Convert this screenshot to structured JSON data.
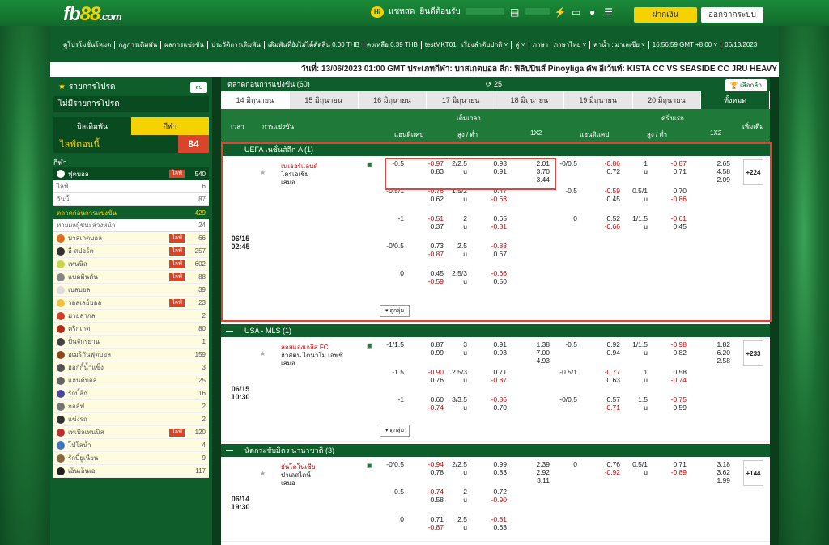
{
  "header": {
    "logo_main": "fb",
    "logo_num": "88",
    "logo_suffix": ".com",
    "chat": "แชทสด",
    "welcome": "ยินดีต้อนรับ",
    "deposit_label": "ฝากเงิน",
    "logout_label": "ออกจากระบบ",
    "hi": "Hi"
  },
  "nav": {
    "left": [
      "ดูโปรโมชั่นโหมด",
      "กฎการเดิมพัน",
      "ผลการแข่งขัน",
      "ประวัติการเดิมพัน",
      "เดิมพันที่ยังไม่ได้ตัดสิน 0.00 THB",
      "คงเหลือ 0.39 THB",
      "testMKT01"
    ],
    "right": [
      "เรียงลำดับปกติ ˅",
      "คู่ ˅",
      "ภาษา : ภาษาไทย ˅",
      "ค่าน้ำ : มาเลเซีย ˅",
      "16:56:59 GMT +8:00 ˅",
      "06/13/2023"
    ]
  },
  "ticker": "วันที่: 13/06/2023 01:00 GMT ประเภทกีฬา: บาสเกตบอล ลีก: ฟิลิปปินส์ Pinoyliga คัพ อีเว้นท์: KISTA CC VS SEASIDE CC JRU HEAVY",
  "sidebar": {
    "fav_title": "รายการโปรด",
    "fav_btn": "ลบ",
    "fav_none": "ไม่มีรายการโปรด",
    "tab_bets": "บิลเดิมพัน",
    "tab_sport": "กีฬา",
    "live_today": "ไลฟ์ตอนนี้",
    "live_count": "84",
    "sports_title": "กีฬา",
    "rows": [
      {
        "label": "ฟุตบอล",
        "live": "ไลฟ์",
        "count": "540",
        "style": "dk",
        "color": "#ffffff"
      },
      {
        "label": "ไลฟ์",
        "count": "6",
        "style": "wh"
      },
      {
        "label": "วันนี้",
        "count": "87",
        "style": "wh"
      },
      {
        "label": "ตลาดก่อนการแข่งขัน",
        "count": "429",
        "style": "hl"
      },
      {
        "label": "ทายผลผู้ชนะล่วงหน้า",
        "count": "24",
        "style": "wh"
      },
      {
        "label": "บาสเกตบอล",
        "live": "ไลฟ์",
        "count": "66",
        "style": "yl",
        "color": "#e07020"
      },
      {
        "label": "อี-สปอร์ต",
        "live": "ไลฟ์",
        "count": "257",
        "style": "yl",
        "color": "#333333"
      },
      {
        "label": "เทนนิส",
        "live": "ไลฟ์",
        "count": "602",
        "style": "yl",
        "color": "#c8d64a"
      },
      {
        "label": "แบดมินตัน",
        "live": "ไลฟ์",
        "count": "88",
        "style": "yl",
        "color": "#888888"
      },
      {
        "label": "เบสบอล",
        "count": "39",
        "style": "yl",
        "color": "#dddddd"
      },
      {
        "label": "วอลเลย์บอล",
        "live": "ไลฟ์",
        "count": "23",
        "style": "yl",
        "color": "#f0c040"
      },
      {
        "label": "มวยสากล",
        "count": "2",
        "style": "yl",
        "color": "#d04030"
      },
      {
        "label": "คริกเกต",
        "count": "80",
        "style": "yl",
        "color": "#b03020"
      },
      {
        "label": "ปั่นจักรยาน",
        "count": "1",
        "style": "yl",
        "color": "#444444"
      },
      {
        "label": "อเมริกันฟุตบอล",
        "count": "159",
        "style": "yl",
        "color": "#8a4a20"
      },
      {
        "label": "ฮอกกี้น้ำแข็ง",
        "count": "3",
        "style": "yl",
        "color": "#555555"
      },
      {
        "label": "แฮนด์บอล",
        "count": "25",
        "style": "yl",
        "color": "#666666"
      },
      {
        "label": "รักบี้ลีก",
        "count": "16",
        "style": "yl",
        "color": "#4a4a9a"
      },
      {
        "label": "กอล์ฟ",
        "count": "2",
        "style": "yl",
        "color": "#777777"
      },
      {
        "label": "แข่งรถ",
        "count": "2",
        "style": "yl",
        "color": "#333333"
      },
      {
        "label": "เทเบิลเทนนิส",
        "live": "ไลฟ์",
        "count": "120",
        "style": "yl",
        "color": "#c03030"
      },
      {
        "label": "โปโลน้ำ",
        "count": "4",
        "style": "yl",
        "color": "#3a7ac0"
      },
      {
        "label": "รักบี้ยูเนียน",
        "count": "9",
        "style": "yl",
        "color": "#8a6a40"
      },
      {
        "label": "เอ็นเอ็นเอ",
        "count": "117",
        "style": "yl",
        "color": "#222222"
      }
    ]
  },
  "main": {
    "title": "ตลาดก่อนการแข่งขัน (60)",
    "refresh": "25",
    "select_label": "เลือกลีก",
    "date_tabs": [
      "14 มิถุนายน",
      "15 มิถุนายน",
      "16 มิถุนายน",
      "17 มิถุนายน",
      "18 มิถุนายน",
      "19 มิถุนายน",
      "20 มิถุนายน",
      "ทั้งหมด"
    ],
    "cols": {
      "time": "เวลา",
      "match": "การแข่งขัน",
      "fulltime": "เต็มเวลา",
      "halftime": "ครึ่งแรก",
      "hdp": "แฮนดิแคป",
      "ou": "สูง / ต่ำ",
      "x12": "1X2",
      "more": "เพิ่มเติม"
    },
    "expand": "ดูกลุ่ม"
  },
  "leagues": [
    {
      "name": "UEFA เนชั่นส์ลีก A (1)",
      "time": "06/15",
      "time2": "02:45",
      "home": "เนเธอร์แลนด์",
      "away": "โครเอเชีย",
      "draw": "เสมอ",
      "more": "+224",
      "rows": [
        [
          "-0.5",
          "-0.97",
          "0.83",
          "2/2.5",
          "u",
          "0.93",
          "0.91",
          "2.01",
          "3.70",
          "3.44",
          "-0/0.5",
          "-0.86",
          "0.72",
          "1",
          "u",
          "-0.87",
          "0.71",
          "2.65",
          "4.58",
          "2.09"
        ],
        [
          "-0.5/1",
          "-0.76",
          "0.62",
          "1.5/2",
          "u",
          "0.47",
          "-0.63",
          "",
          "",
          "",
          "-0.5",
          "-0.59",
          "0.45",
          "0.5/1",
          "u",
          "0.70",
          "-0.86",
          "",
          "",
          ""
        ],
        [
          "-1",
          "-0.51",
          "0.37",
          "2",
          "u",
          "0.65",
          "-0.81",
          "",
          "",
          "",
          "0",
          "0.52",
          "-0.66",
          "1/1.5",
          "u",
          "-0.61",
          "0.45",
          "",
          "",
          ""
        ],
        [
          "-0/0.5",
          "0.73",
          "-0.87",
          "2.5",
          "u",
          "-0.83",
          "0.67",
          "",
          "",
          "",
          "",
          "",
          "",
          "",
          "",
          "",
          "",
          "",
          "",
          ""
        ],
        [
          "0",
          "0.45",
          "-0.59",
          "2.5/3",
          "u",
          "-0.66",
          "0.50",
          "",
          "",
          "",
          "",
          "",
          "",
          "",
          "",
          "",
          "",
          "",
          "",
          ""
        ]
      ]
    },
    {
      "name": "USA - MLS (1)",
      "time": "06/15",
      "time2": "10:30",
      "home": "ลอสแองเจลิส FC",
      "away": "ฮิวสตัน ไดนาโม เอฟซี",
      "draw": "เสมอ",
      "more": "+233",
      "rows": [
        [
          "-1/1.5",
          "0.87",
          "0.99",
          "3",
          "u",
          "0.91",
          "0.93",
          "1.38",
          "7.00",
          "4.93",
          "-0.5",
          "0.92",
          "0.94",
          "1/1.5",
          "u",
          "-0.98",
          "0.82",
          "1.82",
          "6.20",
          "2.58"
        ],
        [
          "-1.5",
          "-0.90",
          "0.76",
          "2.5/3",
          "u",
          "0.71",
          "-0.87",
          "",
          "",
          "",
          "-0.5/1",
          "-0.77",
          "0.63",
          "1",
          "u",
          "0.58",
          "-0.74",
          "",
          "",
          ""
        ],
        [
          "-1",
          "0.60",
          "-0.74",
          "3/3.5",
          "u",
          "-0.86",
          "0.70",
          "",
          "",
          "",
          "-0/0.5",
          "0.57",
          "-0.71",
          "1.5",
          "u",
          "-0.75",
          "0.59",
          "",
          "",
          ""
        ]
      ]
    },
    {
      "name": "นัดกระชับมิตร นานาชาติ (3)",
      "time": "06/14",
      "time2": "19:30",
      "home": "ยันโคโนเซีย",
      "away": "ปาเลสไตน์",
      "draw": "เสมอ",
      "more": "+144",
      "rows": [
        [
          "-0/0.5",
          "-0.94",
          "0.78",
          "2/2.5",
          "u",
          "0.99",
          "0.83",
          "2.39",
          "2.92",
          "3.11",
          "0",
          "0.76",
          "-0.92",
          "0.5/1",
          "u",
          "0.71",
          "-0.89",
          "3.18",
          "3.62",
          "1.99"
        ],
        [
          "-0.5",
          "-0.74",
          "0.58",
          "2",
          "u",
          "0.72",
          "-0.90",
          "",
          "",
          "",
          "",
          "",
          "",
          "",
          "",
          "",
          "",
          "",
          "",
          ""
        ],
        [
          "0",
          "0.71",
          "-0.87",
          "2.5",
          "u",
          "-0.81",
          "0.63",
          "",
          "",
          "",
          "",
          "",
          "",
          "",
          "",
          "",
          "",
          "",
          "",
          ""
        ]
      ]
    }
  ]
}
